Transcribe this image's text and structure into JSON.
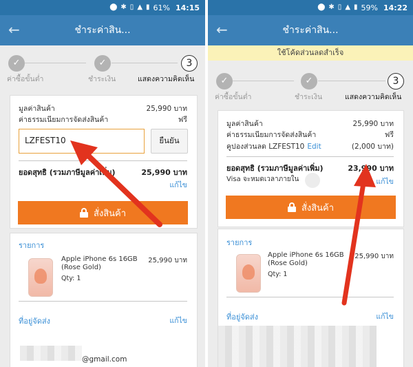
{
  "status_bar": {
    "left": {
      "battery": "61%",
      "time": "14:15"
    },
    "right": {
      "battery": "59%",
      "time": "14:22"
    },
    "icons": [
      "location-icon",
      "bluetooth-icon",
      "vibrate-icon",
      "signal-icon",
      "battery-icon"
    ]
  },
  "app_bar": {
    "title": "ชำระค่าสิน...",
    "back_icon": "arrow-left-icon"
  },
  "promo_banner": "ใช้โค้ดส่วนลดสำเร็จ",
  "steps": [
    {
      "label": "ค่าซื้อขั้นต่ำ",
      "marker": "✓",
      "state": "done"
    },
    {
      "label": "ชำระเงิน",
      "marker": "✓",
      "state": "done"
    },
    {
      "label": "แสดงความคิดเห็น",
      "marker": "3",
      "state": "active"
    }
  ],
  "summary": {
    "subtotal_label": "มูลค่าสินค้า",
    "subtotal_value": "25,990 บาท",
    "shipping_label": "ค่าธรรมเนียมการจัดส่งสินค้า",
    "shipping_value": "ฟรี",
    "coupon_label": "คูปองส่วนลด LZFEST10",
    "coupon_edit": "Edit",
    "coupon_value": "(2,000 บาท)",
    "coupon_input_value": "LZFEST10",
    "confirm_button": "ยืนยัน",
    "total_label": "ยอดสุทธิ (รวมภาษีมูลค่าเพิ่ม)",
    "total_value_left": "25,990 บาท",
    "total_value_right": "23,990 บาท",
    "edit_link": "แก้ไข",
    "visa_note": "Visa จะหมดเวลาภายใน"
  },
  "order_button": "สั่งสินค้า",
  "items_section": {
    "title": "รายการ",
    "product_name_line1": "Apple iPhone 6s 16GB",
    "product_name_line2": "(Rose Gold)",
    "qty": "Qty: 1",
    "price": "25,990 บาท"
  },
  "address_section": {
    "title": "ที่อยู่จัดส่ง",
    "edit": "แก้ไข",
    "email_fragment": "@gmail.com"
  },
  "colors": {
    "status_bar": "#2a73a9",
    "app_bar": "#3b80b7",
    "order_button": "#f07820",
    "link": "#3a8fd6",
    "promo_banner": "#fbf2b8",
    "arrow": "#e2331e"
  }
}
